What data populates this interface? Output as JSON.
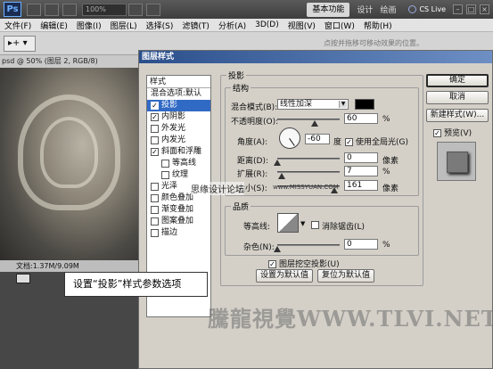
{
  "appbar": {
    "logo": "Ps",
    "zoom": "100%",
    "workspace_active": "基本功能",
    "workspaces": [
      "设计",
      "绘画"
    ],
    "cs_live": "CS Live",
    "win_buttons": [
      "–",
      "□",
      "×"
    ]
  },
  "menubar": {
    "items": [
      "文件(F)",
      "编辑(E)",
      "图像(I)",
      "图层(L)",
      "选择(S)",
      "滤镜(T)",
      "分析(A)",
      "3D(D)",
      "视图(V)",
      "窗口(W)",
      "帮助(H)"
    ]
  },
  "optbar": {
    "preset": "▸+ ▾",
    "hint": "点按并拖移可移动效果的位置。"
  },
  "document": {
    "tab": "psd @ 50% (图层 2, RGB/8)",
    "status": "文档:1.37M/9.09M"
  },
  "callout": "设置“投影”样式参数选项",
  "watermark": "騰龍視覺WWW.TLVI.NET",
  "forum_mark": "思缘设计论坛",
  "forum_url": "www.MISSYUAN.COM",
  "dialog": {
    "title": "图层样式",
    "styles_header": "样式",
    "blend_options": "混合选项:默认",
    "style_items": [
      {
        "label": "投影",
        "checked": true,
        "selected": true,
        "sub": false
      },
      {
        "label": "内阴影",
        "checked": true,
        "selected": false,
        "sub": false
      },
      {
        "label": "外发光",
        "checked": false,
        "selected": false,
        "sub": false
      },
      {
        "label": "内发光",
        "checked": false,
        "selected": false,
        "sub": false
      },
      {
        "label": "斜面和浮雕",
        "checked": true,
        "selected": false,
        "sub": false
      },
      {
        "label": "等高线",
        "checked": false,
        "selected": false,
        "sub": true
      },
      {
        "label": "纹理",
        "checked": false,
        "selected": false,
        "sub": true
      },
      {
        "label": "光泽",
        "checked": false,
        "selected": false,
        "sub": false
      },
      {
        "label": "颜色叠加",
        "checked": false,
        "selected": false,
        "sub": false
      },
      {
        "label": "渐变叠加",
        "checked": false,
        "selected": false,
        "sub": false
      },
      {
        "label": "图案叠加",
        "checked": false,
        "selected": false,
        "sub": false
      },
      {
        "label": "描边",
        "checked": false,
        "selected": false,
        "sub": false
      }
    ],
    "section_title": "投影",
    "structure": {
      "title": "结构",
      "blend_mode_label": "混合模式(B):",
      "blend_mode_value": "线性加深",
      "opacity_label": "不透明度(O):",
      "opacity_value": "60",
      "angle_label": "角度(A):",
      "angle_value": "-60",
      "angle_unit": "度",
      "global_light_label": "使用全局光(G)",
      "distance_label": "距离(D):",
      "distance_value": "0",
      "spread_label": "扩展(R):",
      "spread_value": "7",
      "size_label": "大小(S):",
      "size_value": "161",
      "px": "像素",
      "pct": "%"
    },
    "quality": {
      "title": "品质",
      "contour_label": "等高线:",
      "antialias_label": "消除锯齿(L)",
      "noise_label": "杂色(N):",
      "noise_value": "0",
      "pct": "%"
    },
    "knockout_label": "图层挖空投影(U)",
    "make_default": "设置为默认值",
    "reset_default": "复位为默认值",
    "buttons": {
      "ok": "确定",
      "cancel": "取消",
      "new_style": "新建样式(W)...",
      "preview": "预览(V)"
    }
  }
}
